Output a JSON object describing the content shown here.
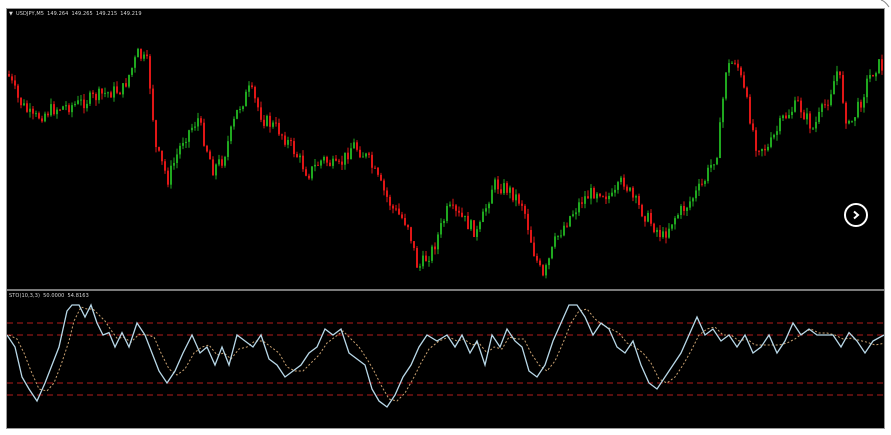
{
  "price_chart": {
    "symbol": "USDJPY,M5",
    "quote_values": [
      "149.264",
      "149.265",
      "149.215",
      "149.219"
    ],
    "bull_color": "#1fa81f",
    "bear_color": "#e01616",
    "background": "#000000"
  },
  "oscillator": {
    "name": "STO(10,3,3)",
    "main_value": "50.0000",
    "signal_value": "54.8163",
    "main_color": "#b8d8e8",
    "signal_color": "#c8a070",
    "level_color": "#b01c1c",
    "levels": [
      80,
      70,
      30,
      20
    ]
  },
  "navigation": {
    "scroll_icon": "chevron-right-icon"
  }
}
